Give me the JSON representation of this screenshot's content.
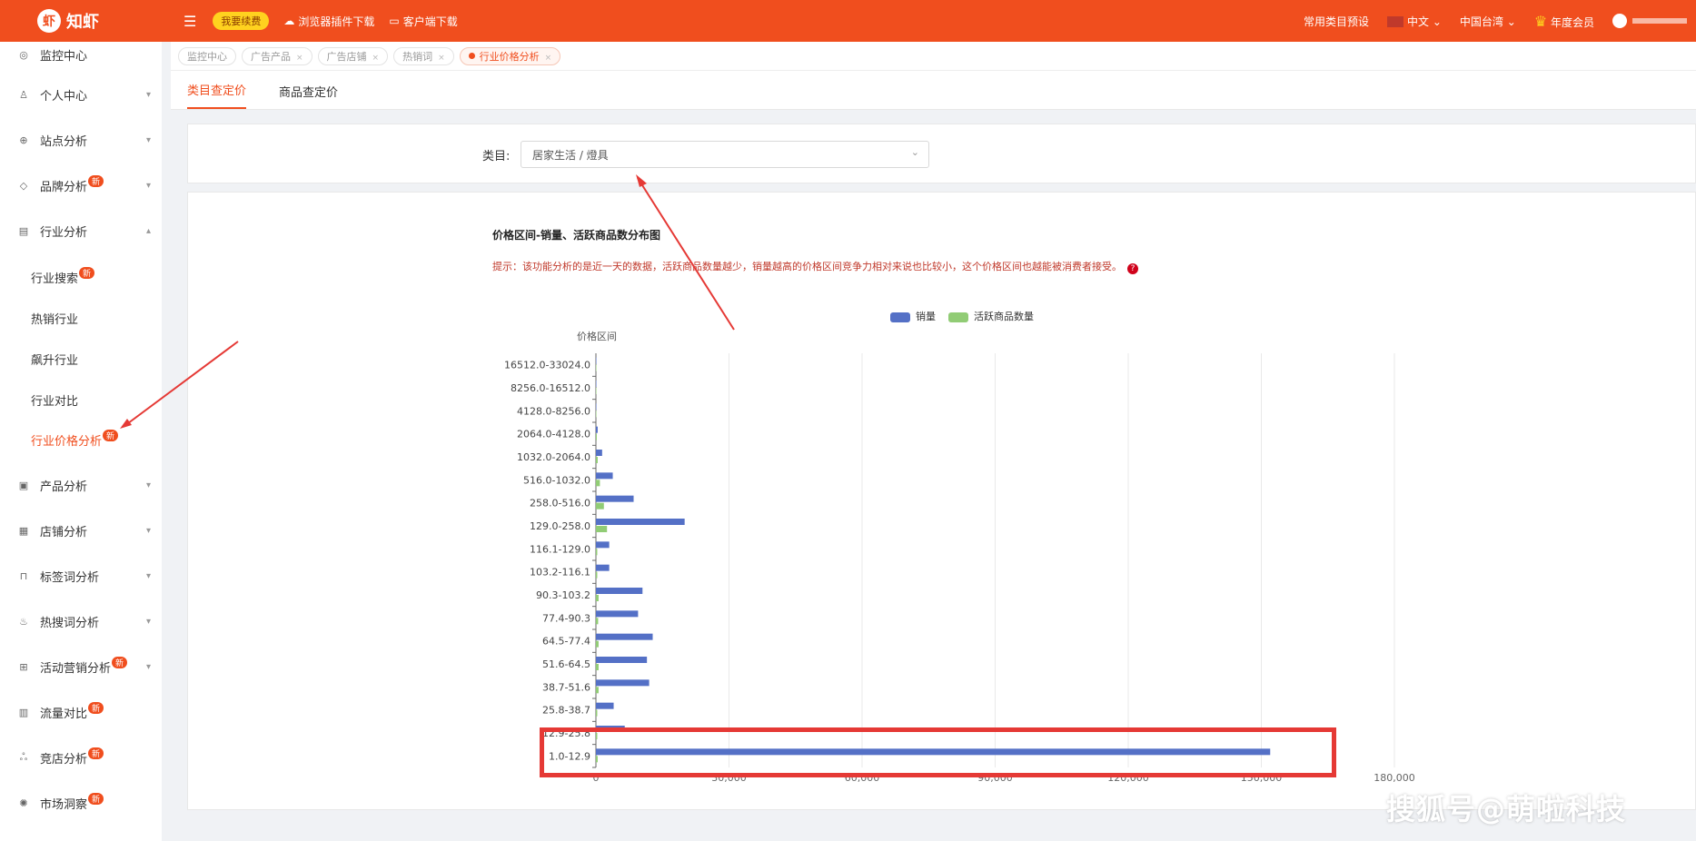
{
  "header": {
    "logo_text": "知虾",
    "renew_label": "我要续费",
    "plugin_label": "浏览器插件下载",
    "client_label": "客户端下载",
    "preset_label": "常用类目预设",
    "language": "中文",
    "region": "中国台湾",
    "membership": "年度会员"
  },
  "sidebar": {
    "items": [
      {
        "label": "监控中心",
        "icon": "dashboard-icon"
      },
      {
        "label": "个人中心",
        "icon": "user-icon"
      },
      {
        "label": "站点分析",
        "icon": "globe-icon"
      },
      {
        "label": "品牌分析",
        "icon": "tag-icon",
        "badge": "新"
      },
      {
        "label": "行业分析",
        "icon": "chart-icon"
      },
      {
        "label": "行业搜索",
        "badge": "新"
      },
      {
        "label": "热销行业"
      },
      {
        "label": "飙升行业"
      },
      {
        "label": "行业对比"
      },
      {
        "label": "行业价格分析",
        "badge": "新"
      },
      {
        "label": "产品分析",
        "icon": "box-icon"
      },
      {
        "label": "店铺分析",
        "icon": "store-icon"
      },
      {
        "label": "标签词分析",
        "icon": "bookmark-icon"
      },
      {
        "label": "热搜词分析",
        "icon": "fire-icon"
      },
      {
        "label": "活动营销分析",
        "icon": "gift-icon",
        "badge": "新"
      },
      {
        "label": "流量对比",
        "icon": "flow-icon",
        "badge": "新"
      },
      {
        "label": "竞店分析",
        "icon": "compete-icon",
        "badge": "新"
      },
      {
        "label": "市场洞察",
        "icon": "insight-icon",
        "badge": "新"
      }
    ]
  },
  "tabs": [
    {
      "label": "监控中心"
    },
    {
      "label": "广告产品"
    },
    {
      "label": "广告店铺"
    },
    {
      "label": "热销词"
    },
    {
      "label": "行业价格分析"
    }
  ],
  "subtabs": [
    "类目查定价",
    "商品查定价"
  ],
  "filter": {
    "label": "类目:",
    "value": "居家生活 / 燈具"
  },
  "chart_title": "价格区间-销量、活跃商品数分布图",
  "chart_hint": "提示：该功能分析的是近一天的数据，活跃商品数量越少，销量越高的价格区间竞争力相对来说也比较小，这个价格区间也越能被消费者接受。",
  "watermark": "搜狐号@萌啦科技",
  "colors": {
    "sales": "#5470c6",
    "active": "#91cc75",
    "accent": "#f04e1e"
  },
  "chart_data": {
    "type": "bar",
    "orientation": "horizontal",
    "ylabel": "价格区间",
    "categories": [
      "1.0-12.9",
      "12.9-25.8",
      "25.8-38.7",
      "38.7-51.6",
      "51.6-64.5",
      "64.5-77.4",
      "77.4-90.3",
      "90.3-103.2",
      "103.2-116.1",
      "116.1-129.0",
      "129.0-258.0",
      "258.0-516.0",
      "516.0-1032.0",
      "1032.0-2064.0",
      "2064.0-4128.0",
      "4128.0-8256.0",
      "8256.0-16512.0",
      "16512.0-33024.0"
    ],
    "xlim": [
      0,
      180000
    ],
    "xticks": [
      "0",
      "30,000",
      "60,000",
      "90,000",
      "120,000",
      "150,000",
      "180,000"
    ],
    "series": [
      {
        "name": "销量",
        "values": [
          152000,
          6500,
          4000,
          12000,
          11500,
          12800,
          9500,
          10500,
          3000,
          3000,
          20000,
          8500,
          3800,
          1400,
          400,
          100,
          50,
          30
        ]
      },
      {
        "name": "活跃商品数量",
        "values": [
          400,
          300,
          300,
          600,
          600,
          600,
          500,
          600,
          300,
          300,
          2500,
          1800,
          900,
          400,
          200,
          50,
          30,
          20
        ]
      }
    ],
    "legend_position": "top"
  }
}
